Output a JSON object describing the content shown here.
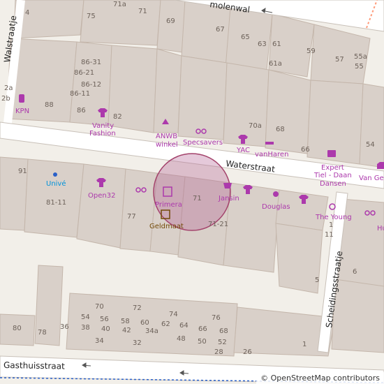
{
  "streets": {
    "waterstraat": "Waterstraat",
    "walstraatje": "Walstraatje",
    "scheidingsstraatje": "Scheidingsstraatje",
    "gasthuisstraat": "Gasthuisstraat",
    "molenwal": "molenwal"
  },
  "pois": {
    "kpn": "KPN",
    "vanity": "Vanity",
    "fashion": "Fashion",
    "anwb": "ANWB",
    "winkel": "winkel",
    "specsavers": "Specsavers",
    "yac": "YAC",
    "vanharen": "vanHaren",
    "expert": "Expert",
    "tiel_daan": "Tiel - Daan",
    "dansen": "Dansen",
    "van_ge": "Van Ge",
    "unive": "Univé",
    "open32": "Open32",
    "primera": "Primera",
    "geldmaat": "Geldmaat",
    "jansin": "Jansin",
    "douglas": "Douglas",
    "the_young": "The Young",
    "hu": "Hu"
  },
  "house_numbers": [
    "4",
    "75",
    "71a",
    "71",
    "69",
    "67",
    "65",
    "63",
    "61",
    "59",
    "57",
    "55a",
    "55",
    "86-31",
    "86-21",
    "86-12",
    "86-11",
    "86",
    "82",
    "61a",
    "88",
    "2a",
    "2b",
    "70a",
    "68",
    "66",
    "54",
    "91",
    "81-11",
    "77",
    "71",
    "71-21",
    "1",
    "11",
    "6",
    "5",
    "70",
    "72",
    "74",
    "76",
    "54",
    "56",
    "58",
    "60",
    "62",
    "64",
    "66",
    "68",
    "80",
    "36",
    "38",
    "40",
    "42",
    "34a",
    "78",
    "34",
    "32",
    "48",
    "50",
    "52",
    "28",
    "26",
    "1"
  ],
  "attribution": "© OpenStreetMap contributors"
}
